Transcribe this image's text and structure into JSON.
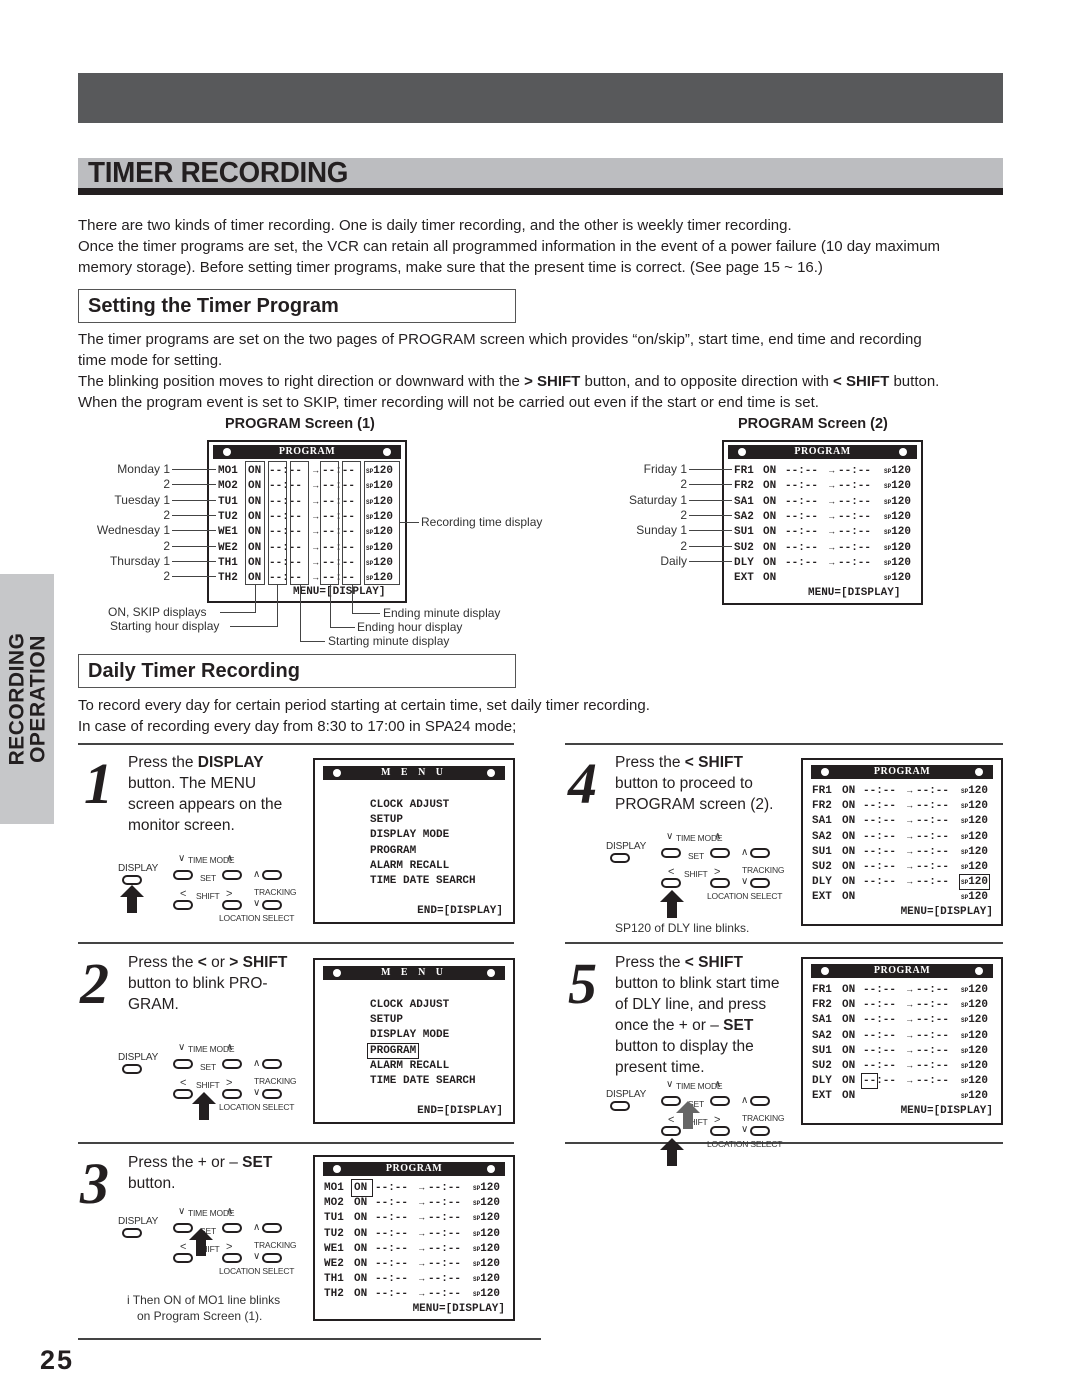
{
  "page": {
    "title": "TIMER RECORDING",
    "page_number": "25",
    "side_tab": [
      "RECORDING",
      "OPERATION"
    ]
  },
  "intro": [
    "There are two kinds of timer recording. One is daily timer recording, and the other is weekly timer recording.",
    "Once the timer programs are set, the VCR can retain all programmed information in the event of a power failure (10 day maximum",
    "memory storage). Before setting timer programs, make sure that the present time is correct. (See page 15 ~ 16.)"
  ],
  "setting": {
    "heading": "Setting the Timer Program",
    "lines": [
      "The timer programs are set on the two pages of PROGRAM screen which provides “on/skip”, start time, end time and recording",
      "time mode for setting.",
      "When the program event is set to SKIP, timer recording will not be carried out even if the start or end time is set."
    ],
    "shift_line": {
      "a": "The blinking position moves to right direction or downward with the ",
      "b": "SHIFT",
      "c": " button, and to opposite direction with ",
      "d": "SHIFT",
      "e": " button."
    },
    "screen1_caption": "PROGRAM Screen (1)",
    "screen2_caption": "PROGRAM Screen (2)"
  },
  "screen1": {
    "header": "PROGRAM",
    "rows": [
      {
        "day": "Monday 1",
        "code": "MO1",
        "state": "ON",
        "start": "--:--",
        "end": "--:--",
        "mode": "SP",
        "time": "120"
      },
      {
        "day": "2",
        "code": "MO2",
        "state": "ON",
        "start": "--:--",
        "end": "--:--",
        "mode": "SP",
        "time": "120"
      },
      {
        "day": "Tuesday 1",
        "code": "TU1",
        "state": "ON",
        "start": "--:--",
        "end": "--:--",
        "mode": "SP",
        "time": "120"
      },
      {
        "day": "2",
        "code": "TU2",
        "state": "ON",
        "start": "--:--",
        "end": "--:--",
        "mode": "SP",
        "time": "120"
      },
      {
        "day": "Wednesday 1",
        "code": "WE1",
        "state": "ON",
        "start": "--:--",
        "end": "--:--",
        "mode": "SP",
        "time": "120"
      },
      {
        "day": "2",
        "code": "WE2",
        "state": "ON",
        "start": "--:--",
        "end": "--:--",
        "mode": "SP",
        "time": "120"
      },
      {
        "day": "Thursday 1",
        "code": "TH1",
        "state": "ON",
        "start": "--:--",
        "end": "--:--",
        "mode": "SP",
        "time": "120"
      },
      {
        "day": "2",
        "code": "TH2",
        "state": "ON",
        "start": "--:--",
        "end": "--:--",
        "mode": "SP",
        "time": "120"
      }
    ],
    "footer": "MENU=[DISPLAY]",
    "callouts": {
      "recording_time": "Recording time display",
      "on_skip": "ON, SKIP displays",
      "start_hour": "Starting hour display",
      "start_minute": "Starting minute display",
      "end_hour": "Ending hour display",
      "end_minute": "Ending minute display"
    }
  },
  "screen2": {
    "header": "PROGRAM",
    "rows": [
      {
        "day": "Friday 1",
        "code": "FR1",
        "state": "ON",
        "start": "--:--",
        "end": "--:--",
        "mode": "SP",
        "time": "120"
      },
      {
        "day": "2",
        "code": "FR2",
        "state": "ON",
        "start": "--:--",
        "end": "--:--",
        "mode": "SP",
        "time": "120"
      },
      {
        "day": "Saturday 1",
        "code": "SA1",
        "state": "ON",
        "start": "--:--",
        "end": "--:--",
        "mode": "SP",
        "time": "120"
      },
      {
        "day": "2",
        "code": "SA2",
        "state": "ON",
        "start": "--:--",
        "end": "--:--",
        "mode": "SP",
        "time": "120"
      },
      {
        "day": "Sunday 1",
        "code": "SU1",
        "state": "ON",
        "start": "--:--",
        "end": "--:--",
        "mode": "SP",
        "time": "120"
      },
      {
        "day": "2",
        "code": "SU2",
        "state": "ON",
        "start": "--:--",
        "end": "--:--",
        "mode": "SP",
        "time": "120"
      },
      {
        "day": "Daily",
        "code": "DLY",
        "state": "ON",
        "start": "--:--",
        "end": "--:--",
        "mode": "SP",
        "time": "120"
      },
      {
        "day": "",
        "code": "EXT",
        "state": "ON",
        "start": "",
        "end": "",
        "mode": "SP",
        "time": "120"
      }
    ],
    "footer": "MENU=[DISPLAY]"
  },
  "daily": {
    "heading": "Daily Timer Recording",
    "lines": [
      "To record every day for certain period starting at certain time, set daily timer recording.",
      "In case of recording every day from 8:30 to 17:00 in SPA24 mode;"
    ]
  },
  "remote": {
    "display": "DISPLAY",
    "time_mode": "TIME MODE",
    "set": "SET",
    "shift": "SHIFT",
    "tracking": "TRACKING",
    "location_select": "LOCATION SELECT"
  },
  "menu_screen": {
    "header": "M E N U",
    "items": [
      "CLOCK ADJUST",
      "SETUP",
      "DISPLAY MODE",
      "PROGRAM",
      "ALARM RECALL",
      "TIME DATE SEARCH"
    ],
    "footer": "END=[DISPLAY]"
  },
  "steps": [
    {
      "num": "1",
      "lines": [
        "Press the |DISPLAY|",
        "button. The MENU",
        "screen appears on the",
        "monitor screen."
      ]
    },
    {
      "num": "2",
      "lines": [
        "Press the < or > SHIFT",
        "button to blink PRO-",
        "GRAM."
      ]
    },
    {
      "num": "3",
      "lines": [
        "Press the + or – SET",
        "button."
      ],
      "note": [
        "i  Then ON of MO1 line blinks",
        "on Program Screen (1)."
      ]
    },
    {
      "num": "4",
      "lines": [
        "Press the < SHIFT",
        "button to proceed to",
        "PROGRAM screen (2)."
      ],
      "note": [
        "SP120 of DLY line blinks."
      ]
    },
    {
      "num": "5",
      "lines": [
        "Press the < SHIFT",
        "button to blink start time",
        "of DLY line, and press",
        "once the + or – SET",
        "button to display the",
        "present time."
      ]
    }
  ],
  "step_bold": {
    "s1": "DISPLAY",
    "s2_pre": "Press the ",
    "s2_or": " or ",
    "s2_bold": "SHIFT",
    "s3_pre": "Press the + or – ",
    "s3_bold": "SET",
    "s4_pre": "Press the ",
    "s4_bold": "SHIFT",
    "s5_pre": "Press the ",
    "s5_bold": "SHIFT",
    "s5_l4_pre": "once the + or – ",
    "s5_l4_bold": "SET"
  }
}
